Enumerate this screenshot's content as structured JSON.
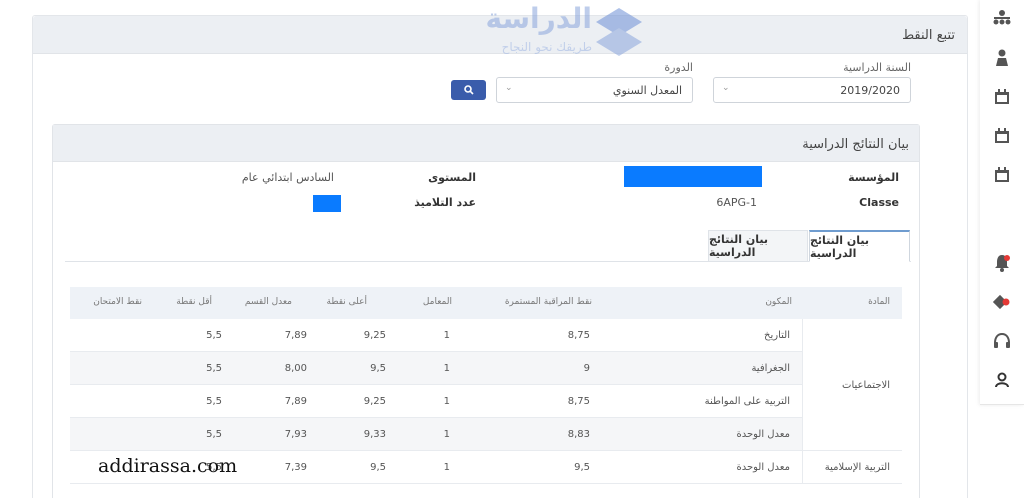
{
  "page": {
    "title": "تتبع النقط"
  },
  "logo": {
    "main": "الدراسة",
    "sub": "طريقك نحو النجاح"
  },
  "filters": {
    "year_label": "السنة الدراسية",
    "year_value": "2019/2020",
    "session_label": "الدورة",
    "session_value": "المعدل السنوي"
  },
  "results": {
    "title": "بيان النتائج الدراسية",
    "institution_label": "المؤسسة",
    "level_label": "المستوى",
    "level_value": "السادس ابتدائي عام",
    "classe_label": "Classe",
    "classe_value": "6APG-1",
    "students_label": "عدد التلاميذ"
  },
  "tabs": [
    {
      "label": "بيان النتائج الدراسية"
    },
    {
      "label": "بيان النتائج الدراسية"
    }
  ],
  "table": {
    "headers": [
      "المادة",
      "المكون",
      "نقط المراقبة المستمرة",
      "المعامل",
      "أعلى نقطة",
      "معدل القسم",
      "أقل نقطة",
      "نقط الامتحان"
    ],
    "groups": [
      "الاجتماعيات",
      "التربية الإسلامية"
    ],
    "rows": [
      [
        "التاريخ",
        "8,75",
        "1",
        "9,25",
        "7,89",
        "5,5"
      ],
      [
        "الجغرافية",
        "9",
        "1",
        "9,5",
        "8,00",
        "5,5"
      ],
      [
        "التربية على المواطنة",
        "8,75",
        "1",
        "9,25",
        "7,89",
        "5,5"
      ],
      [
        "معدل الوحدة",
        "8,83",
        "1",
        "9,33",
        "7,93",
        "5,5"
      ],
      [
        "معدل الوحدة",
        "9,5",
        "1",
        "9,5",
        "7,39",
        "5,5"
      ]
    ]
  },
  "watermark": "addirassa.com"
}
